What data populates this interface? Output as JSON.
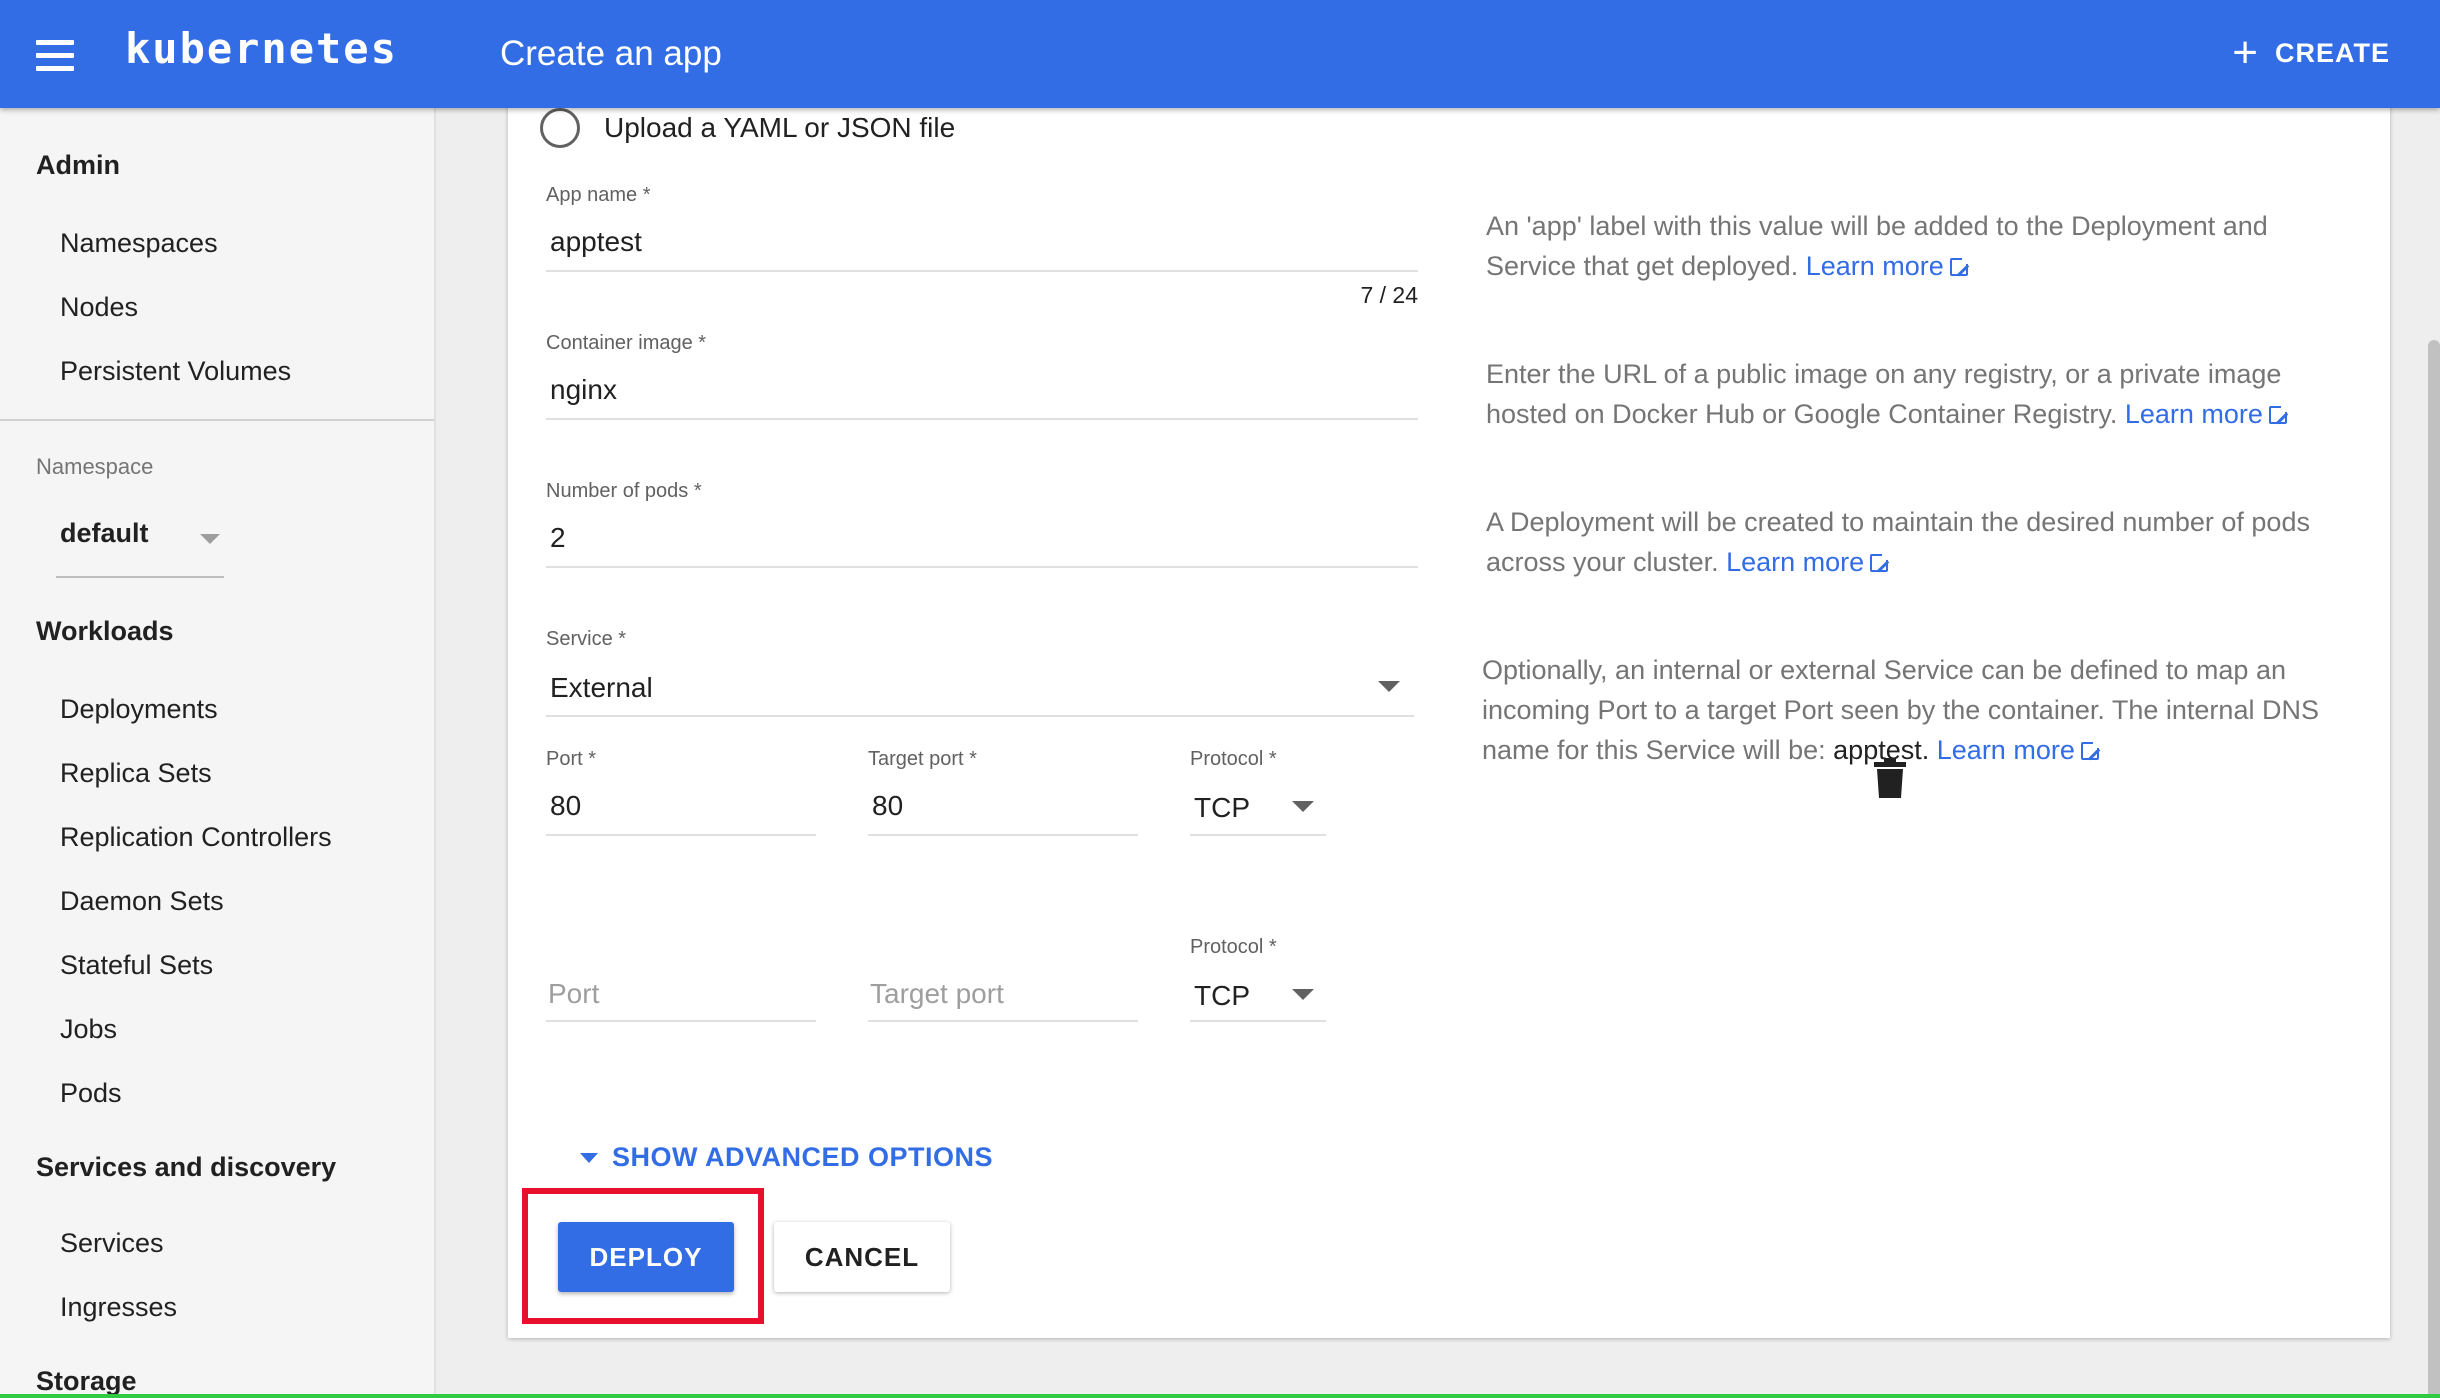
{
  "topbar": {
    "brand": "kubernetes",
    "title": "Create an app",
    "create_label": "CREATE"
  },
  "sidebar": {
    "admin_heading": "Admin",
    "admin_items": [
      "Namespaces",
      "Nodes",
      "Persistent Volumes"
    ],
    "namespace_label": "Namespace",
    "namespace_value": "default",
    "workloads_heading": "Workloads",
    "workloads_items": [
      "Deployments",
      "Replica Sets",
      "Replication Controllers",
      "Daemon Sets",
      "Stateful Sets",
      "Jobs",
      "Pods"
    ],
    "services_heading": "Services and discovery",
    "services_items": [
      "Services",
      "Ingresses"
    ],
    "storage_heading": "Storage"
  },
  "form": {
    "upload_option": "Upload a YAML or JSON file",
    "app_name": {
      "label": "App name *",
      "value": "apptest",
      "counter": "7 / 24"
    },
    "container_image": {
      "label": "Container image *",
      "value": "nginx"
    },
    "pods": {
      "label": "Number of pods *",
      "value": "2"
    },
    "service": {
      "label": "Service *",
      "value": "External"
    },
    "port_row1": {
      "port_label": "Port *",
      "port_value": "80",
      "target_label": "Target port *",
      "target_value": "80",
      "protocol_label": "Protocol *",
      "protocol_value": "TCP"
    },
    "port_row2": {
      "port_placeholder": "Port",
      "target_placeholder": "Target port",
      "protocol_label": "Protocol *",
      "protocol_value": "TCP"
    },
    "advanced_label": "SHOW ADVANCED OPTIONS",
    "deploy_label": "DEPLOY",
    "cancel_label": "CANCEL"
  },
  "help": {
    "app_name": "An 'app' label with this value will be added to the Deployment and Service that get deployed.",
    "container_image": "Enter the URL of a public image on any registry, or a private image hosted on Docker Hub or Google Container Registry.",
    "pods": "A Deployment will be created to maintain the desired number of pods across your cluster.",
    "service_prefix": "Optionally, an internal or external Service can be defined to map an incoming Port to a target Port seen by the container. The internal DNS name for this Service will be:",
    "service_name": "apptest",
    "service_period": ".",
    "learn_more": "Learn more"
  },
  "colors": {
    "primary": "#326de6",
    "highlight": "#e8112d"
  }
}
